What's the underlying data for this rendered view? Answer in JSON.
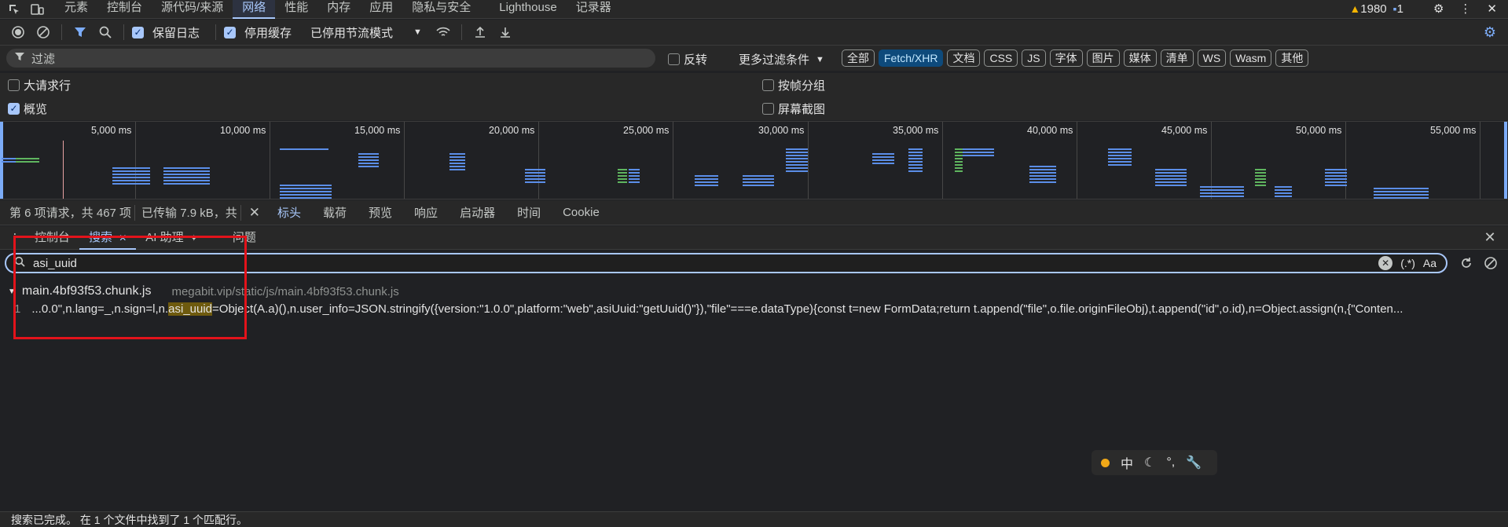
{
  "top_tabs": [
    "元素",
    "控制台",
    "源代码/来源",
    "网络",
    "性能",
    "内存",
    "应用",
    "隐私与安全",
    "Lighthouse",
    "记录器"
  ],
  "top_active_tab": "网络",
  "top_right": {
    "warnings": "1980",
    "messages": "1"
  },
  "toolbar": {
    "preserve_log": "保留日志",
    "disable_cache": "停用缓存",
    "throttle": "已停用节流模式"
  },
  "filter": {
    "placeholder": "过滤",
    "invert": "反转",
    "more_filters": "更多过滤条件",
    "types": [
      "全部",
      "Fetch/XHR",
      "文档",
      "CSS",
      "JS",
      "字体",
      "图片",
      "媒体",
      "清单",
      "WS",
      "Wasm",
      "其他"
    ],
    "active_type": "Fetch/XHR"
  },
  "options": {
    "big_rows": "大请求行",
    "group_by_frame": "按帧分组",
    "overview": "概览",
    "screenshots": "屏幕截图"
  },
  "overview": {
    "ticks": [
      "5,000 ms",
      "10,000 ms",
      "15,000 ms",
      "20,000 ms",
      "25,000 ms",
      "30,000 ms",
      "35,000 ms",
      "40,000 ms",
      "45,000 ms",
      "50,000 ms",
      "55,000 ms"
    ]
  },
  "status": {
    "requests": "第 6 项请求，共 467 项",
    "transferred": "已传输 7.9 kB，共",
    "detail_tabs": [
      "标头",
      "载荷",
      "预览",
      "响应",
      "启动器",
      "时间",
      "Cookie"
    ]
  },
  "drawer": {
    "tabs": [
      "控制台",
      "搜索",
      "AI 助理",
      "问题"
    ],
    "active": "搜索"
  },
  "search": {
    "query": "asi_uuid",
    "regex_label": "(.*)",
    "case_label": "Aa",
    "result_file": "main.4bf93f53.chunk.js",
    "result_path": "megabit.vip/static/js/main.4bf93f53.chunk.js",
    "line_no": "1",
    "line_pre": "...0.0\",n.lang=_,n.sign=l,n.",
    "line_match": "asi_uuid",
    "line_post": "=Object(A.a)(),n.user_info=JSON.stringify({version:\"1.0.0\",platform:\"web\",asiUuid:\"getUuid()\"}),\"file\"===e.dataType){const t=new FormData;return t.append(\"file\",o.file.originFileObj),t.append(\"id\",o.id),n=Object.assign(n,{\"Conten..."
  },
  "ime": {
    "mode": "中"
  },
  "footer": "搜索已完成。 在 1 个文件中找到了 1 个匹配行。"
}
